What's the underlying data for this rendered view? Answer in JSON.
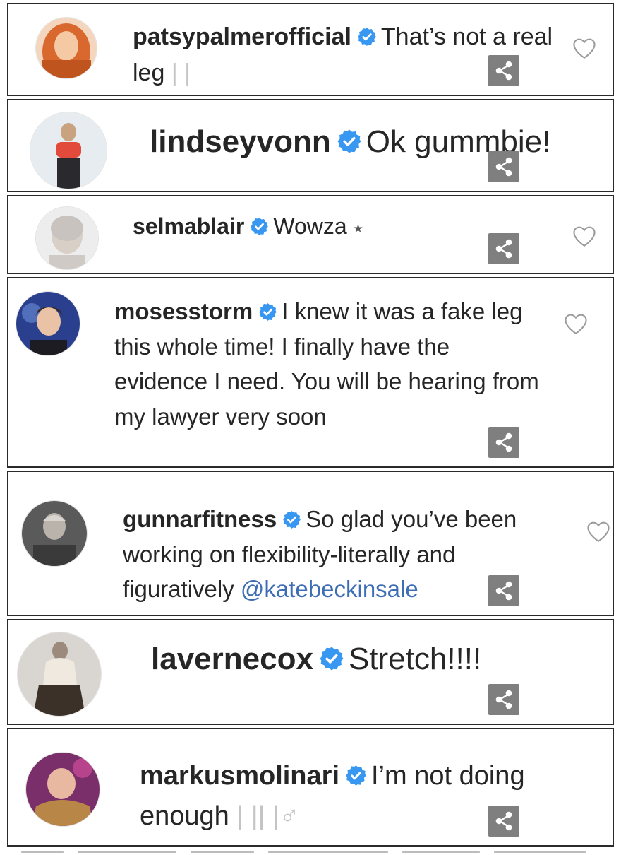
{
  "comments": [
    {
      "username": "patsypalmerofficial",
      "text": "That’s not a real leg",
      "tail": "| |",
      "mention": "",
      "has_heart": true
    },
    {
      "username": "lindseyvonn",
      "text": "Ok gummbie!",
      "tail": "",
      "mention": "",
      "has_heart": false
    },
    {
      "username": "selmablair",
      "text": "Wowza",
      "tail": "⭑",
      "mention": "",
      "has_heart": true
    },
    {
      "username": "mosesstorm",
      "text": "I knew it was a fake leg this whole time! I finally have the evidence I need. You will be hearing from my lawyer very soon",
      "tail": "",
      "mention": "",
      "has_heart": true
    },
    {
      "username": "gunnarfitness",
      "text": "So glad you’ve been working on flexibility-literally and figuratively",
      "tail": "",
      "mention": "@katebeckinsale",
      "has_heart": true
    },
    {
      "username": "lavernecox",
      "text": "Stretch!!!!",
      "tail": "",
      "mention": "",
      "has_heart": false
    },
    {
      "username": "markusmolinari",
      "text": "I’m not doing enough",
      "tail": "| || |♂",
      "mention": "",
      "has_heart": false
    }
  ],
  "icons": {
    "verified": "verified-badge-icon",
    "like": "heart-outline-icon",
    "share": "share-icon"
  },
  "colors": {
    "verified_blue": "#3897f0",
    "mention_blue": "#3d6db5",
    "share_gray": "#7f7f7f",
    "border": "#2a2a2a"
  }
}
